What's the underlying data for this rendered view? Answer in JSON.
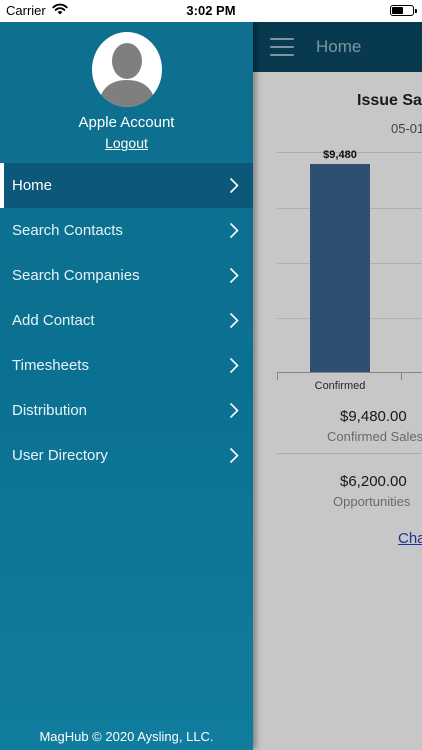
{
  "status_bar": {
    "carrier": "Carrier",
    "time": "3:02 PM",
    "battery_level": 0.6
  },
  "header": {
    "title": "Home"
  },
  "report": {
    "title": "Issue Sal",
    "date": "05-01",
    "metrics": [
      {
        "value": "$9,480.00",
        "label": "Confirmed Sales"
      },
      {
        "value": "$6,200.00",
        "label": "Opportunities"
      }
    ],
    "link_label": "Cha"
  },
  "chart_data": {
    "type": "bar",
    "categories": [
      "Confirmed"
    ],
    "values": [
      9480
    ],
    "data_labels": [
      "$9,480"
    ],
    "ylim": [
      0,
      10000
    ]
  },
  "drawer": {
    "account_name": "Apple Account",
    "logout_label": "Logout",
    "items": [
      {
        "label": "Home",
        "active": true
      },
      {
        "label": "Search Contacts",
        "active": false
      },
      {
        "label": "Search Companies",
        "active": false
      },
      {
        "label": "Add Contact",
        "active": false
      },
      {
        "label": "Timesheets",
        "active": false
      },
      {
        "label": "Distribution",
        "active": false
      },
      {
        "label": "User Directory",
        "active": false
      }
    ],
    "footer": "MagHub © 2020 Aysling, LLC."
  },
  "colors": {
    "drawer": "#0e6f8e",
    "active_item": "#0b587a",
    "topbar": "#0a4a66",
    "bar": "#3c6694"
  },
  "icons": {
    "hamburger": "menu-icon",
    "chevron": "chevron-right-icon",
    "avatar": "user-silhouette-icon",
    "wifi": "wifi-icon",
    "battery": "battery-icon"
  }
}
